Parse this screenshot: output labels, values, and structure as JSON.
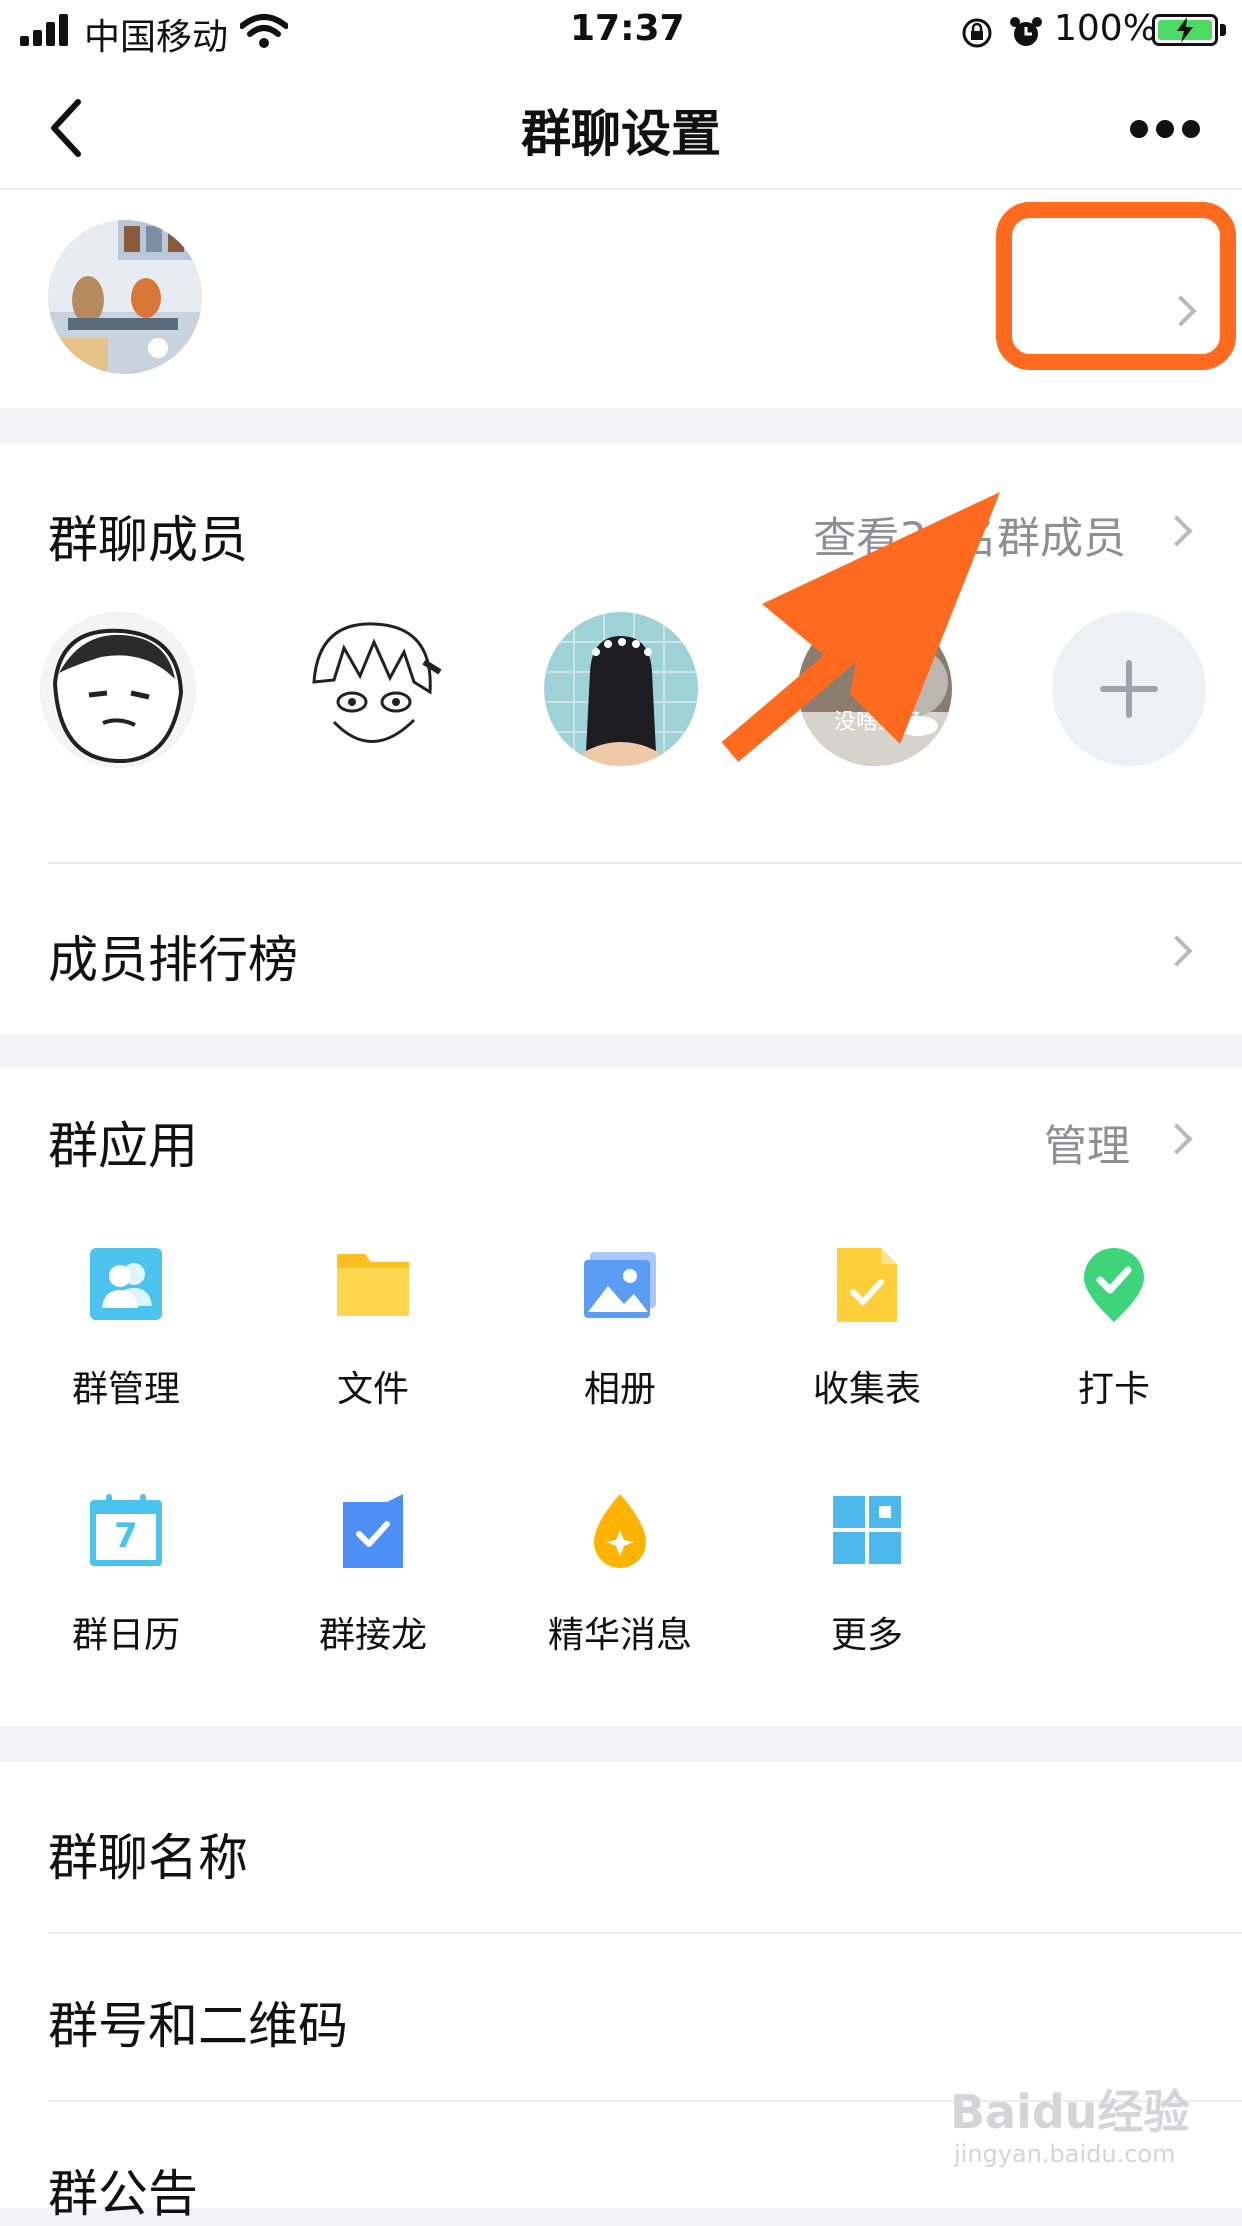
{
  "status_bar": {
    "carrier": "中国移动",
    "time": "17:37",
    "battery": "100%"
  },
  "nav": {
    "back_icon": "chevron-left-icon",
    "title": "群聊设置",
    "more_icon": "more-dots-icon"
  },
  "members": {
    "label": "群聊成员",
    "view_all": "查看30名群成员",
    "avatar_overlay_text": "没啥致了",
    "add_icon": "plus-icon"
  },
  "ranking": {
    "label": "成员排行榜"
  },
  "apps": {
    "label": "群应用",
    "manage": "管理",
    "items": [
      {
        "label": "群管理",
        "icon": "group-manage-icon",
        "color": "#4cc3ee"
      },
      {
        "label": "文件",
        "icon": "folder-icon",
        "color": "#ffcf3a"
      },
      {
        "label": "相册",
        "icon": "album-icon",
        "color": "#5b9cf5"
      },
      {
        "label": "收集表",
        "icon": "form-icon",
        "color": "#ffcf3a"
      },
      {
        "label": "打卡",
        "icon": "check-in-icon",
        "color": "#3dd47b"
      },
      {
        "label": "群日历",
        "icon": "calendar-icon",
        "color": "#4cc3ee"
      },
      {
        "label": "群接龙",
        "icon": "relay-icon",
        "color": "#4e8ff7"
      },
      {
        "label": "精华消息",
        "icon": "essence-icon",
        "color": "#ffb300"
      },
      {
        "label": "更多",
        "icon": "grid-more-icon",
        "color": "#4cb8ec"
      }
    ],
    "calendar_day": "7"
  },
  "settings": [
    {
      "label": "群聊名称"
    },
    {
      "label": "群号和二维码"
    },
    {
      "label": "群公告"
    }
  ],
  "watermark": {
    "brand": "Baidu经验",
    "url": "jingyan.baidu.com"
  },
  "colors": {
    "annotation": "#ff6a1f",
    "accent_gray": "#8e8e93"
  }
}
